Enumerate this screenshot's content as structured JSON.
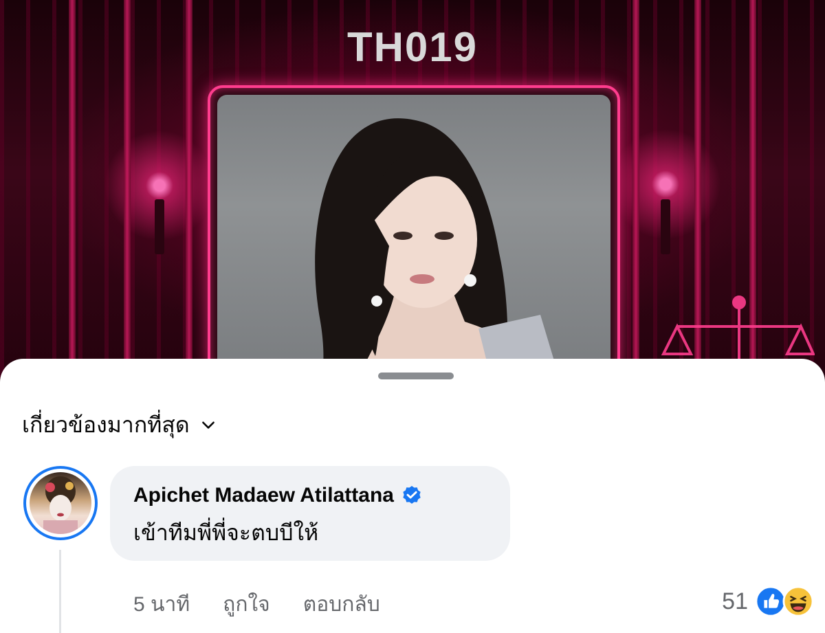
{
  "banner": {
    "title": "TH019"
  },
  "comments_sheet": {
    "sort_label": "เกี่ยวข้องมากที่สุด",
    "comment": {
      "author": "Apichet Madaew Atilattana",
      "verified": true,
      "text": "เข้าทีมพี่พี่จะตบบีให้",
      "time": "5 นาที",
      "like_action": "ถูกใจ",
      "reply_action": "ตอบกลับ",
      "reaction_count": "51",
      "reaction_icons": [
        "like-icon",
        "haha-icon"
      ]
    }
  },
  "colors": {
    "accent_pink": "#ff3d8e",
    "facebook_blue": "#1877f2",
    "bubble_bg": "#f0f2f5",
    "meta_gray": "#65676b"
  }
}
